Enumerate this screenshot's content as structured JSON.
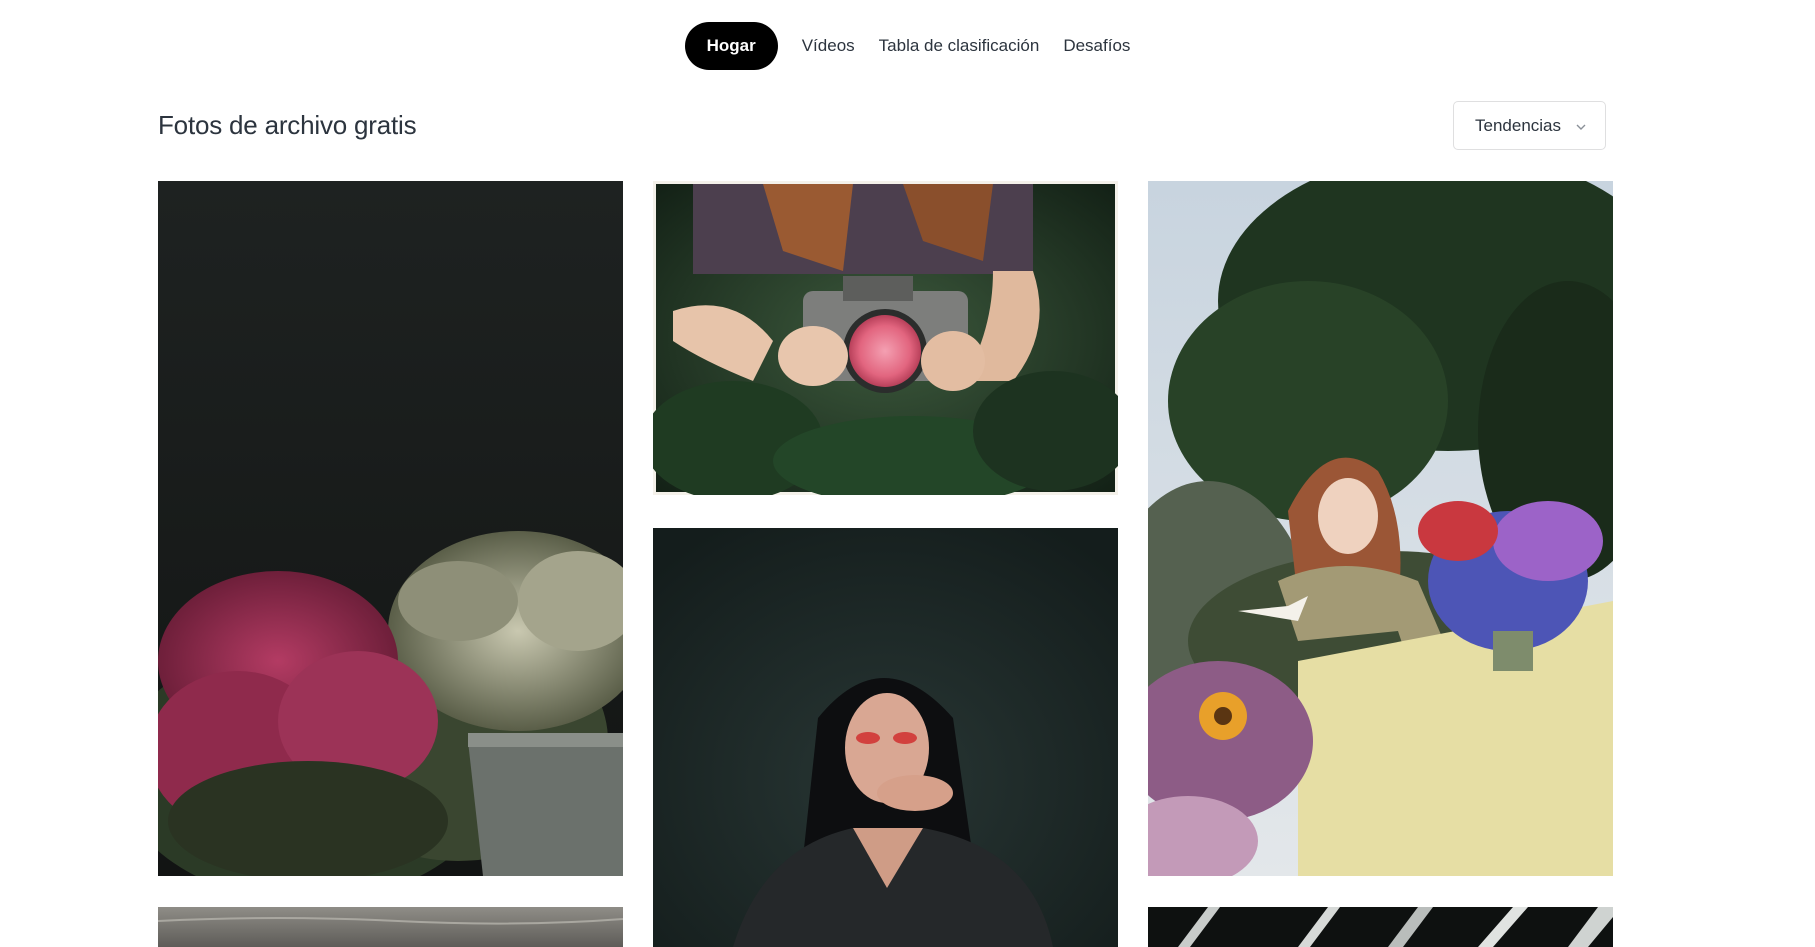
{
  "nav": {
    "items": [
      {
        "label": "Hogar",
        "active": true
      },
      {
        "label": "Vídeos",
        "active": false
      },
      {
        "label": "Tabla de clasificación",
        "active": false
      },
      {
        "label": "Desafíos",
        "active": false
      }
    ]
  },
  "main": {
    "title": "Fotos de archivo gratis",
    "sort_label": "Tendencias"
  },
  "photos": [
    {
      "subject": "flowers-in-bucket"
    },
    {
      "subject": "camera-with-rose"
    },
    {
      "subject": "woman-reading-at-flower-table"
    },
    {
      "subject": "woman-portrait-red-eyeshadow"
    },
    {
      "subject": "gray-water-surface"
    },
    {
      "subject": "architecture-lines"
    }
  ],
  "colors": {
    "nav_active_bg": "#000000",
    "nav_active_text": "#ffffff",
    "text": "#2c343e",
    "border": "#dfdfe0"
  },
  "icons": {
    "sort": "chevron-down-icon"
  }
}
